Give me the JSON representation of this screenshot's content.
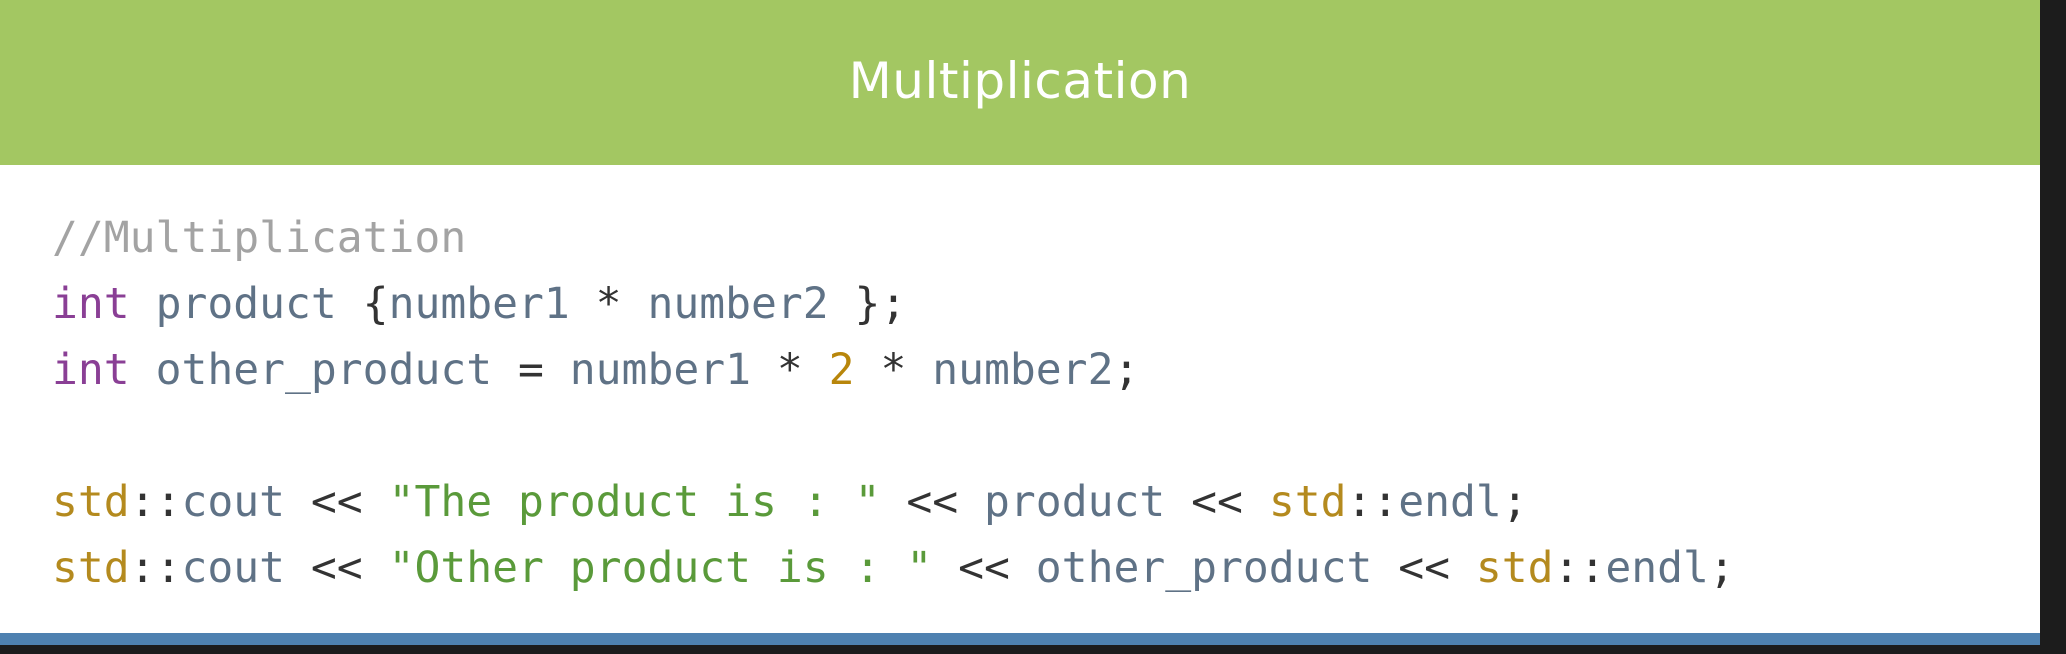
{
  "slide": {
    "title": "Multiplication"
  },
  "code": {
    "lines": [
      [
        {
          "type": "comment",
          "text": "//Multiplication"
        }
      ],
      [
        {
          "type": "keyword",
          "text": "int"
        },
        {
          "type": "punct",
          "text": " "
        },
        {
          "type": "ident",
          "text": "product"
        },
        {
          "type": "punct",
          "text": " {"
        },
        {
          "type": "ident",
          "text": "number1"
        },
        {
          "type": "punct",
          "text": " * "
        },
        {
          "type": "ident",
          "text": "number2"
        },
        {
          "type": "punct",
          "text": " };"
        }
      ],
      [
        {
          "type": "keyword",
          "text": "int"
        },
        {
          "type": "punct",
          "text": " "
        },
        {
          "type": "ident",
          "text": "other_product"
        },
        {
          "type": "punct",
          "text": " = "
        },
        {
          "type": "ident",
          "text": "number1"
        },
        {
          "type": "punct",
          "text": " * "
        },
        {
          "type": "number",
          "text": "2"
        },
        {
          "type": "punct",
          "text": " * "
        },
        {
          "type": "ident",
          "text": "number2"
        },
        {
          "type": "punct",
          "text": ";"
        }
      ],
      [],
      [
        {
          "type": "ns",
          "text": "std"
        },
        {
          "type": "punct",
          "text": "::"
        },
        {
          "type": "ident",
          "text": "cout"
        },
        {
          "type": "punct",
          "text": " << "
        },
        {
          "type": "string",
          "text": "\"The product is : \""
        },
        {
          "type": "punct",
          "text": " << "
        },
        {
          "type": "ident",
          "text": "product"
        },
        {
          "type": "punct",
          "text": " << "
        },
        {
          "type": "ns",
          "text": "std"
        },
        {
          "type": "punct",
          "text": "::"
        },
        {
          "type": "ident",
          "text": "endl"
        },
        {
          "type": "punct",
          "text": ";"
        }
      ],
      [
        {
          "type": "ns",
          "text": "std"
        },
        {
          "type": "punct",
          "text": "::"
        },
        {
          "type": "ident",
          "text": "cout"
        },
        {
          "type": "punct",
          "text": " << "
        },
        {
          "type": "string",
          "text": "\"Other product is : \""
        },
        {
          "type": "punct",
          "text": " << "
        },
        {
          "type": "ident",
          "text": "other_product"
        },
        {
          "type": "punct",
          "text": " << "
        },
        {
          "type": "ns",
          "text": "std"
        },
        {
          "type": "punct",
          "text": "::"
        },
        {
          "type": "ident",
          "text": "endl"
        },
        {
          "type": "punct",
          "text": ";"
        }
      ]
    ]
  },
  "colors": {
    "title_band": "#a3c762",
    "title_text": "#ffffff",
    "bottom_strip": "#4e81b0",
    "comment": "#a3a3a3",
    "keyword": "#8a3f95",
    "identifier": "#5f7286",
    "number": "#b8860b",
    "string": "#5a9a3a",
    "namespace": "#b48a1e"
  }
}
